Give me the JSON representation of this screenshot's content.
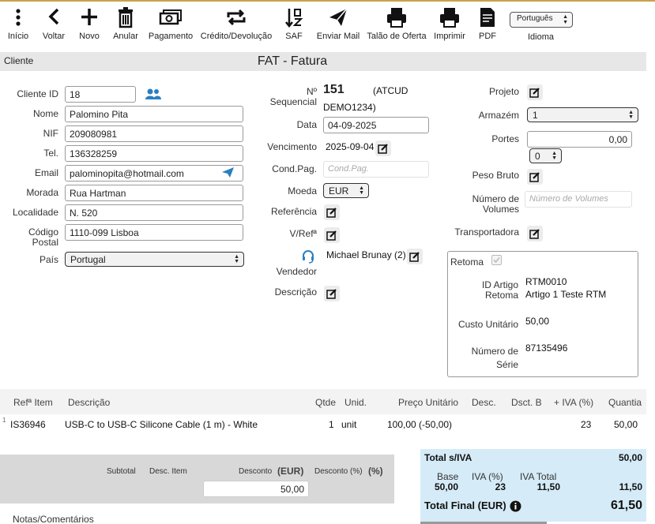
{
  "toolbar": {
    "items": [
      {
        "label": "Início",
        "icon": "more-vertical-icon"
      },
      {
        "label": "Voltar",
        "icon": "chevron-left-icon"
      },
      {
        "label": "Novo",
        "icon": "plus-icon"
      },
      {
        "label": "Anular",
        "icon": "trash-icon"
      },
      {
        "label": "Pagamento",
        "icon": "money-icon"
      },
      {
        "label": "Crédito/Devolução",
        "icon": "repeat-icon"
      },
      {
        "label": "SAF",
        "icon": "sort-icon"
      },
      {
        "label": "Enviar Mail",
        "icon": "send-icon"
      },
      {
        "label": "Talão de Oferta",
        "icon": "printer-icon"
      },
      {
        "label": "Imprimir",
        "icon": "printer-icon"
      },
      {
        "label": "PDF",
        "icon": "document-icon"
      }
    ],
    "language_value": "Português",
    "language_label": "Idioma"
  },
  "titlebar": {
    "left": "Cliente",
    "title": "FAT - Fatura"
  },
  "client": {
    "id_label": "Cliente ID",
    "id_value": "18",
    "name_label": "Nome",
    "name_value": "Palomino Pita",
    "nif_label": "NIF",
    "nif_value": "209080981",
    "tel_label": "Tel.",
    "tel_value": "136328259",
    "email_label": "Email",
    "email_value": "palominopita@hotmail.com",
    "morada_label": "Morada",
    "morada_value": "Rua Hartman",
    "localidade_label": "Localidade",
    "localidade_value": "N. 520",
    "cp_label_1": "Código",
    "cp_label_2": "Postal",
    "cp_value": "1110-099 Lisboa",
    "pais_label": "País",
    "pais_value": "Portugal"
  },
  "document": {
    "numero_label_1": "Nº",
    "numero_label_2": "Sequencial",
    "numero_value": "151",
    "atcud_1": "(ATCUD",
    "atcud_2": "DEMO1234)",
    "data_label": "Data",
    "data_value": "04-09-2025",
    "venc_label": "Vencimento",
    "venc_value": "2025-09-04",
    "condpag_label": "Cond.Pag.",
    "condpag_placeholder": "Cond.Pag.",
    "moeda_label": "Moeda",
    "moeda_value": "EUR",
    "referencia_label": "Referência",
    "vref_label": "V/Refª",
    "vendedor_label": "Vendedor",
    "vendedor_value": "Michael Brunay (2)",
    "descricao_label": "Descrição"
  },
  "right": {
    "projeto_label": "Projeto",
    "armazem_label": "Armazém",
    "armazem_value": "1",
    "portes_label": "Portes",
    "portes_value": "0,00",
    "portes_iva": "0",
    "peso_label": "Peso Bruto",
    "volumes_label_1": "Número de",
    "volumes_label_2": "Volumes",
    "volumes_placeholder": "Número de Volumes",
    "transportadora_label": "Transportadora"
  },
  "retoma": {
    "label": "Retoma",
    "artigo_label_1": "ID Artigo",
    "artigo_label_2": "Retoma",
    "artigo_code": "RTM0010",
    "artigo_name": "Artigo 1 Teste RTM",
    "custo_label": "Custo Unitário",
    "custo_value": "50,00",
    "serie_label_1": "Número de",
    "serie_label_2": "Série",
    "serie_value": "87135496"
  },
  "items_table": {
    "headers": [
      "Refª Item",
      "Descrição",
      "Qtde",
      "Unid.",
      "Preço Unitário",
      "Desc.",
      "Dsct. B",
      "+ IVA (%)",
      "Quantia"
    ],
    "rows": [
      {
        "index": "1",
        "ref": "IS36946",
        "descricao": "USB-C to USB-C Silicone Cable (1 m) - White",
        "qtde": "1",
        "unid": "unit",
        "preco": "100,00 (-50,00)",
        "desc": "",
        "dsctb": "",
        "iva": "23",
        "quantia": "50,00"
      }
    ]
  },
  "discount": {
    "subtotal_label": "Subtotal",
    "desc_item_label": "Desc. Item",
    "desconto_label": "Desconto",
    "desconto_unit": "(EUR)",
    "desconto_pct_label": "Desconto (%)",
    "desconto_pct_unit": "(%)",
    "desconto_value": "50,00"
  },
  "totals": {
    "total_siva_label": "Total s/IVA",
    "total_siva_value": "50,00",
    "base_label": "Base",
    "base_value": "50,00",
    "iva_pct_label": "IVA (%)",
    "iva_pct_value": "23",
    "iva_total_label": "IVA Total",
    "iva_total_value": "11,50",
    "iva_sum_value": "11,50",
    "total_final_label": "Total Final (EUR)",
    "total_final_value": "61,50"
  },
  "notes_label": "Notas/Comentários",
  "colors": {
    "accent": "#2a7fc1",
    "titlebar": "#e7e7e7",
    "totals_bg": "#d5ebf7",
    "discount_bg": "#d8d8d8"
  }
}
